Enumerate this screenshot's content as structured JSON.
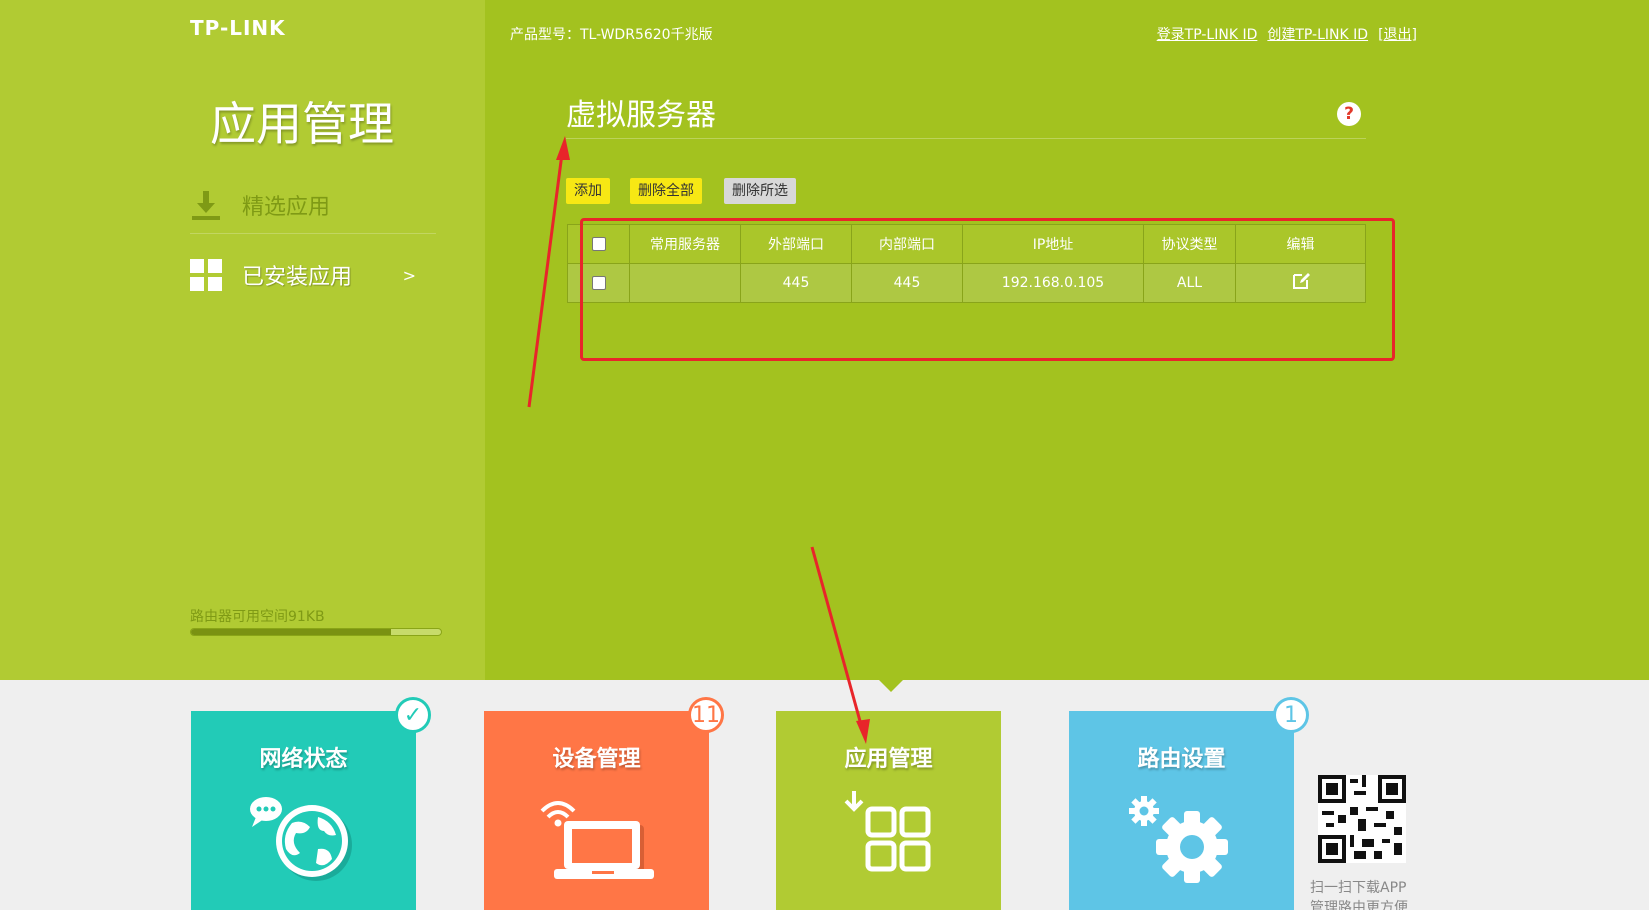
{
  "brand": {
    "logo": "TP-LINK"
  },
  "header": {
    "model": "产品型号：TL-WDR5620千兆版",
    "links": [
      "登录TP-LINK ID",
      "创建TP-LINK ID",
      "[退出]"
    ]
  },
  "sidebar": {
    "title": "应用管理",
    "items": [
      {
        "label": "精选应用",
        "icon": "download-icon"
      },
      {
        "label": "已安装应用",
        "icon": "grid-icon",
        "arrow": ">"
      }
    ],
    "storage": {
      "text": "路由器可用空间91KB",
      "used_fraction": 0.8
    }
  },
  "main": {
    "title": "虚拟服务器",
    "help": "?",
    "buttons": {
      "add": "添加",
      "delete_all": "删除全部",
      "delete_selected": "删除所选"
    },
    "table": {
      "headers": [
        "常用服务器",
        "外部端口",
        "内部端口",
        "IP地址",
        "协议类型",
        "编辑"
      ],
      "rows": [
        {
          "server": "",
          "external_port": "445",
          "internal_port": "445",
          "ip": "192.168.0.105",
          "protocol": "ALL"
        }
      ]
    }
  },
  "tiles": [
    {
      "label": "网络状态",
      "badge": "✓",
      "color": "#22cbb7"
    },
    {
      "label": "设备管理",
      "badge": "11",
      "color": "#ff7646"
    },
    {
      "label": "应用管理",
      "badge": "",
      "color": "#b1cb33"
    },
    {
      "label": "路由设置",
      "badge": "1",
      "color": "#5ec5e6"
    }
  ],
  "qr": {
    "line1": "扫一扫下载APP",
    "line2": "管理路由更方便"
  },
  "annotation_color": "#e8252a"
}
